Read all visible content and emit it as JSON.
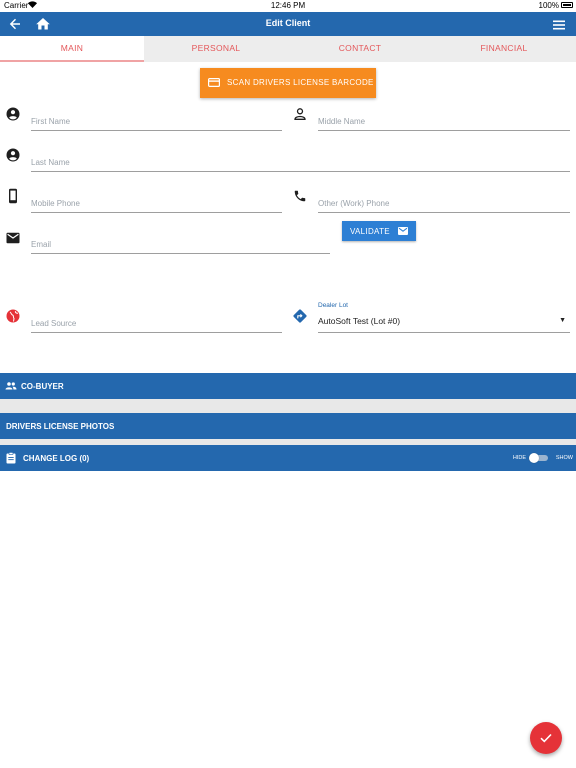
{
  "status_bar": {
    "carrier": "Carrier",
    "time": "12:46 PM",
    "battery": "100%"
  },
  "app_bar": {
    "title": "Edit Client"
  },
  "tabs": [
    {
      "label": "MAIN",
      "active": true
    },
    {
      "label": "PERSONAL",
      "active": false
    },
    {
      "label": "CONTACT",
      "active": false
    },
    {
      "label": "FINANCIAL",
      "active": false
    }
  ],
  "scan_button": {
    "label": "SCAN DRIVERS LICENSE BARCODE"
  },
  "fields": {
    "first_name": {
      "placeholder": "First Name",
      "value": ""
    },
    "middle_name": {
      "placeholder": "Middle Name",
      "value": ""
    },
    "last_name": {
      "placeholder": "Last Name",
      "value": ""
    },
    "mobile_phone": {
      "placeholder": "Mobile Phone",
      "value": ""
    },
    "work_phone": {
      "placeholder": "Other (Work) Phone",
      "value": ""
    },
    "email": {
      "placeholder": "Email",
      "value": ""
    },
    "lead_source": {
      "placeholder": "Lead Source",
      "value": ""
    }
  },
  "validate_button": {
    "label": "VALIDATE"
  },
  "dealer_lot": {
    "label": "Dealer Lot",
    "value": "AutoSoft Test (Lot #0)"
  },
  "sections": {
    "co_buyer": "CO-BUYER",
    "license_photos": "DRIVERS LICENSE PHOTOS",
    "change_log": "CHANGE LOG (0)"
  },
  "change_log_toggle": {
    "hide_label": "HIDE",
    "show_label": "SHOW",
    "state": "hide"
  },
  "colors": {
    "primary": "#2468ae",
    "accent": "#f68b1f",
    "tab_text": "#e4575a",
    "fab": "#e53238",
    "validate": "#2d7fd4",
    "lead_icon": "#e53238"
  },
  "icons": {
    "back": "arrow-left-icon",
    "home": "home-icon",
    "menu": "hamburger-menu-icon",
    "scan": "credit-card-icon",
    "first_name": "account-circle-icon",
    "middle_name": "person-outline-icon",
    "last_name": "account-circle-icon",
    "mobile_phone": "smartphone-icon",
    "work_phone": "phone-icon",
    "email": "envelope-icon",
    "lead_source": "globe-icon",
    "dealer_lot": "directions-icon",
    "co_buyer": "people-icon",
    "change_log": "clipboard-icon",
    "save": "checkmark-icon"
  }
}
